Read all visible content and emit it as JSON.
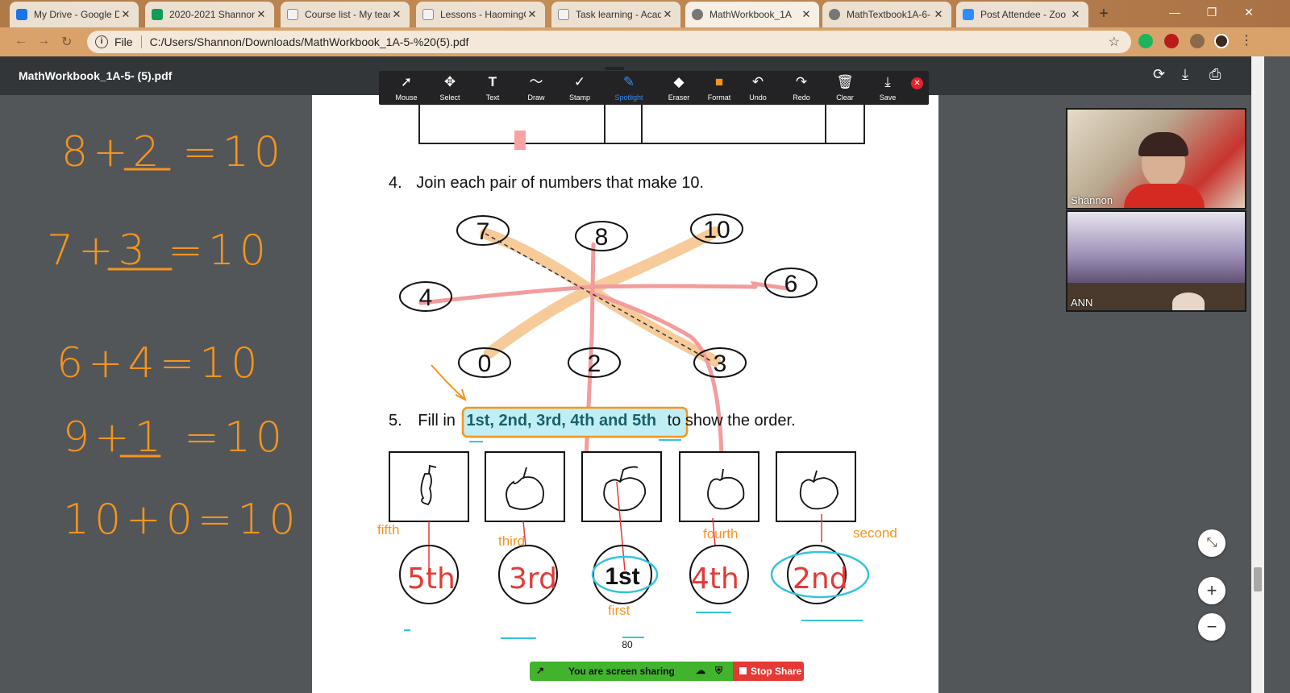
{
  "browser": {
    "tabs": [
      {
        "title": "My Drive - Google D",
        "favicon_color": "#1a73e8"
      },
      {
        "title": "2020-2021 Shannon",
        "favicon_color": "#0f9d58"
      },
      {
        "title": "Course list - My teac",
        "favicon_color": "#f2f2f2"
      },
      {
        "title": "Lessons - HaomingC",
        "favicon_color": "#f2f2f2"
      },
      {
        "title": "Task learning - Acad",
        "favicon_color": "#f2f2f2"
      },
      {
        "title": "MathWorkbook_1A",
        "favicon_color": "#666666"
      },
      {
        "title": "MathTextbook1A-6-",
        "favicon_color": "#666666"
      },
      {
        "title": "Post Attendee - Zoo",
        "favicon_color": "#2d8cff"
      }
    ],
    "close_glyph": "✕",
    "new_tab_glyph": "+",
    "address": {
      "scheme_label": "File",
      "url": "C:/Users/Shannon/Downloads/MathWorkbook_1A-5-%20(5).pdf"
    },
    "window_controls": [
      "—",
      "❐",
      "✕"
    ]
  },
  "pdf_viewer": {
    "title": "MathWorkbook_1A-5- (5).pdf",
    "icons": [
      "rotate-icon",
      "download-icon",
      "print-icon"
    ]
  },
  "annotation_toolbar": {
    "tools": [
      {
        "label": "Mouse",
        "glyph": "➚",
        "active": false
      },
      {
        "label": "Select",
        "glyph": "✥",
        "active": false
      },
      {
        "label": "Text",
        "glyph": "T",
        "active": false
      },
      {
        "label": "Draw",
        "glyph": "〜",
        "active": false
      },
      {
        "label": "Stamp",
        "glyph": "✓",
        "active": false
      },
      {
        "label": "Spotlight",
        "glyph": "✎",
        "active": true
      },
      {
        "label": "Eraser",
        "glyph": "◆",
        "active": false
      },
      {
        "label": "Format",
        "glyph": "■",
        "active": false
      },
      {
        "label": "Undo",
        "glyph": "↶",
        "active": false
      },
      {
        "label": "Redo",
        "glyph": "↷",
        "active": false
      },
      {
        "label": "Clear",
        "glyph": "🗑",
        "active": false
      },
      {
        "label": "Save",
        "glyph": "⤓",
        "active": false
      }
    ],
    "close_glyph": "✕"
  },
  "workbook": {
    "q4": {
      "number": "4.",
      "text": "Join each pair of numbers that make 10."
    },
    "numbers": [
      "7",
      "8",
      "10",
      "4",
      "6",
      "0",
      "2",
      "3"
    ],
    "q5": {
      "number": "5.",
      "prefix": "Fill in",
      "highlight": "1st, 2nd, 3rd, 4th and 5th",
      "suffix": "to show the order."
    },
    "ordinals_written": [
      "5th",
      "3rd",
      "1st",
      "4th",
      "2nd"
    ],
    "ordinal_words": [
      "fifth",
      "third",
      "first",
      "fourth",
      "second"
    ],
    "page_number": "80"
  },
  "handwritten_equations": [
    "8+2 =10",
    "7+3 =10",
    "6+4=10",
    "9+1 =10",
    "10+0=10"
  ],
  "participants": [
    {
      "name": "Shannon"
    },
    {
      "name": "ANN"
    }
  ],
  "zoom_controls": [
    "⤡",
    "+",
    "−"
  ],
  "sharing": {
    "status": "You are screen sharing",
    "stop_label": "Stop Share"
  },
  "colors": {
    "annotation_orange": "#f7941d",
    "annotation_pink": "#f28b8b",
    "annotation_cyan": "#34c3e0",
    "annotation_red": "#e53935"
  }
}
